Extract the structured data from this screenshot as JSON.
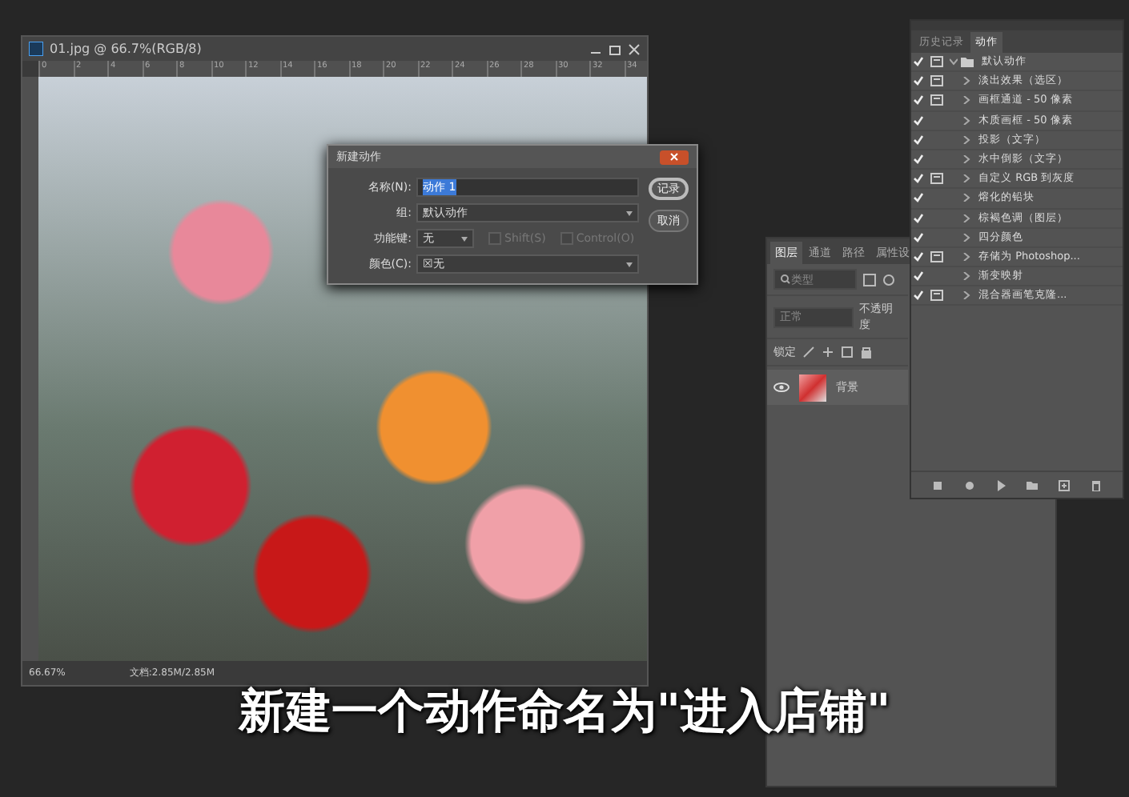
{
  "document": {
    "title": "01.jpg @ 66.7%(RGB/8)",
    "ruler": [
      "0",
      "2",
      "4",
      "6",
      "8",
      "10",
      "12",
      "14",
      "16",
      "18",
      "20",
      "22",
      "24",
      "26",
      "28",
      "30",
      "32",
      "34"
    ],
    "zoom": "66.67%",
    "doc_size": "文档:2.85M/2.85M"
  },
  "dialog": {
    "title": "新建动作",
    "fields": [
      {
        "kind": "text",
        "label": "名称(N):",
        "value": "动作 1",
        "value_selected": true
      },
      {
        "kind": "select",
        "label": "组:",
        "value": "默认动作"
      },
      {
        "kind": "key",
        "label": "功能键:",
        "value": "无",
        "options": [
          {
            "label": "Shift(S)",
            "checked": false,
            "disabled": true
          },
          {
            "label": "Control(O)",
            "checked": false,
            "disabled": true
          }
        ]
      },
      {
        "kind": "color",
        "label": "颜色(C):",
        "swatch": "☒",
        "value": "无"
      }
    ],
    "buttons": [
      {
        "label": "记录",
        "default": true
      },
      {
        "label": "取消",
        "default": false
      }
    ]
  },
  "layers": {
    "tabs": [
      {
        "label": "图层",
        "selected": true
      },
      {
        "label": "通道",
        "selected": false
      },
      {
        "label": "路径",
        "selected": false
      },
      {
        "label": "属性设",
        "selected": false
      }
    ],
    "filter_placeholder": "类型",
    "blend_mode": "正常",
    "opacity_label": "不透明度",
    "lock_label": "锁定",
    "rows": [
      {
        "name": "背景",
        "visible": true
      }
    ]
  },
  "actions": {
    "tabs": [
      {
        "label": "历史记录",
        "selected": false
      },
      {
        "label": "动作",
        "selected": true
      }
    ],
    "sets": [
      {
        "name": "默认动作",
        "enabled": true,
        "dialog": true,
        "expanded": true,
        "children": [
          {
            "name": "淡出效果（选区）",
            "enabled": true,
            "dialog": true,
            "expanded": false
          },
          {
            "name": "画框通道 - 50 像素",
            "enabled": true,
            "dialog": true,
            "expanded": false
          },
          {
            "name": "木质画框 - 50 像素",
            "enabled": true,
            "dialog": false,
            "expanded": false
          },
          {
            "name": "投影（文字）",
            "enabled": true,
            "dialog": false,
            "expanded": false
          },
          {
            "name": "水中倒影（文字）",
            "enabled": true,
            "dialog": false,
            "expanded": false
          },
          {
            "name": "自定义 RGB 到灰度",
            "enabled": true,
            "dialog": true,
            "expanded": false
          },
          {
            "name": "熔化的铅块",
            "enabled": true,
            "dialog": false,
            "expanded": false
          },
          {
            "name": "棕褐色调（图层）",
            "enabled": true,
            "dialog": false,
            "expanded": false
          },
          {
            "name": "四分颜色",
            "enabled": true,
            "dialog": false,
            "expanded": false
          },
          {
            "name": "存储为 Photoshop...",
            "enabled": true,
            "dialog": true,
            "expanded": false
          },
          {
            "name": "渐变映射",
            "enabled": true,
            "dialog": false,
            "expanded": false
          },
          {
            "name": "混合器画笔克隆...",
            "enabled": true,
            "dialog": true,
            "expanded": false
          }
        ]
      }
    ]
  },
  "subtitle": "新建一个动作命名为\"进入店铺\""
}
